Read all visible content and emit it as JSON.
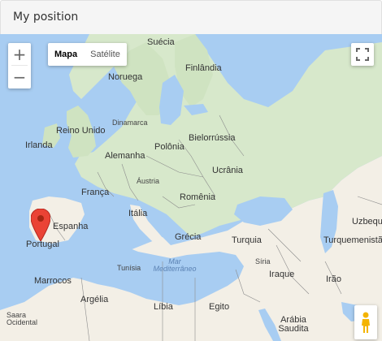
{
  "card": {
    "title": "My position"
  },
  "controls": {
    "zoom_in": "+",
    "zoom_out": "−",
    "map_type_active": "Mapa",
    "map_type_other": "Satélite"
  },
  "map": {
    "countries": [
      "Suécia",
      "Finlândia",
      "Noruega",
      "Dinamarca",
      "Reino Unido",
      "Irlanda",
      "Alemanha",
      "Polônia",
      "Bielorrússia",
      "França",
      "Áustria",
      "Ucrânia",
      "Romênia",
      "Espanha",
      "Itália",
      "Portugal",
      "Grécia",
      "Turquia",
      "Uzbeque",
      "Turquemenistã",
      "Síria",
      "Tunísia",
      "Iraque",
      "Marrocos",
      "Irão",
      "Argélia",
      "Líbia",
      "Egito",
      "Arábia Saudita",
      "Saara Ocidental"
    ],
    "sea": "Mar Mediterrâneo",
    "marker_country": "Portugal"
  },
  "colors": {
    "water": "#a8cdf2",
    "land": "#f3efe6",
    "green": "#cfe3c1",
    "marker": "#ea4335"
  }
}
